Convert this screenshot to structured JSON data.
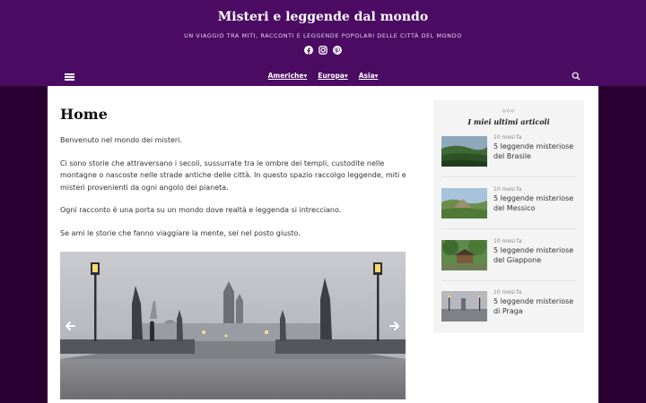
{
  "site": {
    "title": "Misteri e leggende dal mondo",
    "tagline": "UN VIAGGIO TRA MITI, RACCONTI E LEGGENDE POPOLARI DELLE CITTÀ DEL MONDO"
  },
  "social": [
    "facebook-icon",
    "instagram-icon",
    "pinterest-icon"
  ],
  "nav": {
    "items": [
      {
        "label": "Americhe▾"
      },
      {
        "label": "Europa▾"
      },
      {
        "label": "Asia▾"
      }
    ]
  },
  "page": {
    "title": "Home",
    "paragraphs": [
      "Benvenuto nel mondo dei misteri.",
      "Ci sono storie che attraversano i secoli, sussurrate tra le ombre dei templi, custodite nelle montagne o nascoste nelle strade antiche delle città. In questo spazio raccolgo leggende, miti e misteri provenienti da ogni angolo del pianeta.",
      "Ogni racconto è una porta su un mondo dove realtà e leggenda si intrecciano.",
      "Se ami le storie che fanno viaggiare la mente, sei nel posto giusto."
    ]
  },
  "sidebar": {
    "decoration": "◇◇◇",
    "title": "I miei ultimi articoli",
    "posts": [
      {
        "date": "10 mesi fa",
        "title": "5 leggende misteriose del Brasile"
      },
      {
        "date": "10 mesi fa",
        "title": "5 leggende misteriose del Messico"
      },
      {
        "date": "10 mesi fa",
        "title": "5 leggende misteriose del Giappone"
      },
      {
        "date": "10 mesi fa",
        "title": "5 leggende misteriose di Praga"
      }
    ]
  },
  "colors": {
    "header": "#4b0b63",
    "background": "#2a0033"
  }
}
